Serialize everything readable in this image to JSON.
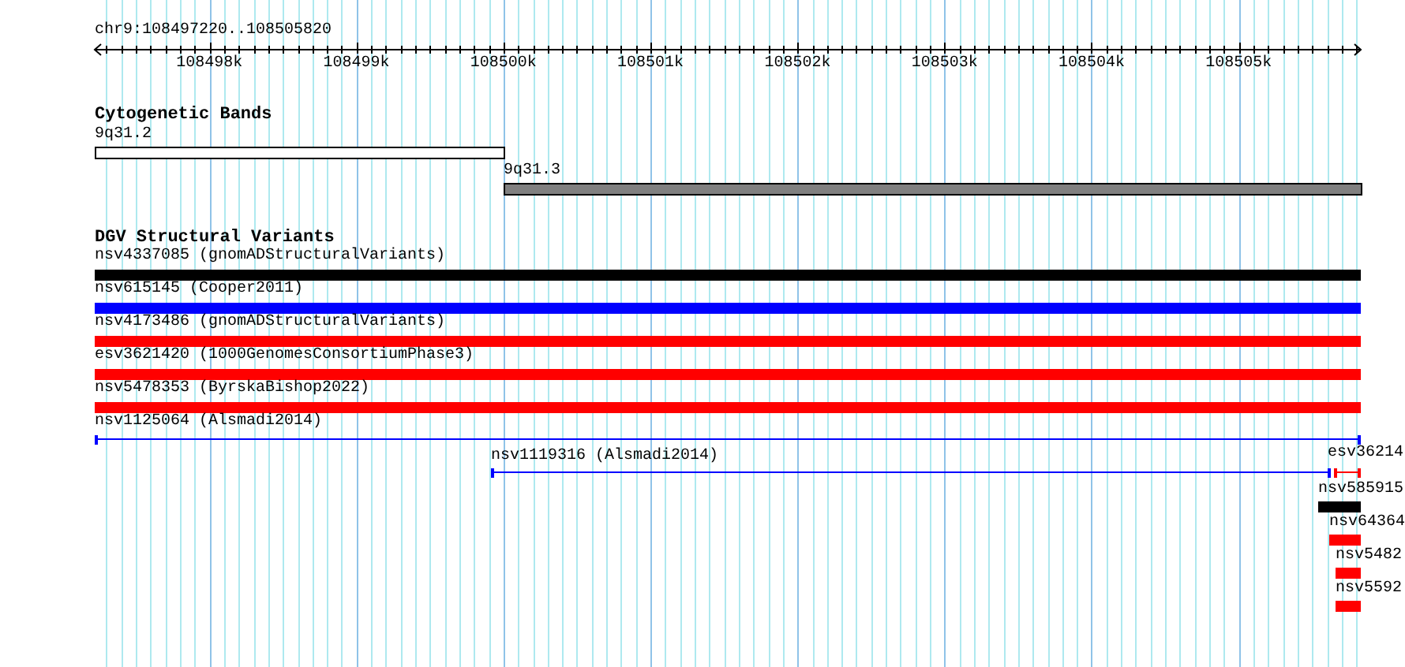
{
  "location": "chr9:108497220..108505820",
  "ruler": {
    "tick_labels": [
      "108498k",
      "108499k",
      "108500k",
      "108501k",
      "108502k",
      "108503k",
      "108504k",
      "108505k"
    ]
  },
  "tracks": [
    {
      "title": "Cytogenetic Bands",
      "features": [
        {
          "kind": "band",
          "label": "9q31.2",
          "color": "#ffffff"
        },
        {
          "kind": "band",
          "label": "9q31.3",
          "color": "#808080"
        }
      ]
    },
    {
      "title": "DGV Structural Variants",
      "features": [
        {
          "kind": "bar",
          "label": "nsv4337085 (gnomADStructuralVariants)",
          "color": "#000000"
        },
        {
          "kind": "bar",
          "label": "nsv615145 (Cooper2011)",
          "color": "#0000ff"
        },
        {
          "kind": "bar",
          "label": "nsv4173486 (gnomADStructuralVariants)",
          "color": "#ff0000"
        },
        {
          "kind": "bar",
          "label": "esv3621420 (1000GenomesConsortiumPhase3)",
          "color": "#ff0000"
        },
        {
          "kind": "bar",
          "label": "nsv5478353 (ByrskaBishop2022)",
          "color": "#ff0000"
        },
        {
          "kind": "line",
          "label": "nsv1125064 (Alsmadi2014)",
          "color": "#0000ff"
        },
        {
          "kind": "line",
          "label": "nsv1119316 (Alsmadi2014)",
          "color": "#0000ff"
        },
        {
          "kind": "line",
          "label": "esv36214",
          "color": "#ff0000"
        },
        {
          "kind": "bar",
          "label": "nsv585915",
          "color": "#000000"
        },
        {
          "kind": "bar",
          "label": "nsv64364",
          "color": "#ff0000"
        },
        {
          "kind": "bar",
          "label": "nsv5482",
          "color": "#ff0000"
        },
        {
          "kind": "bar",
          "label": "nsv5592",
          "color": "#ff0000"
        }
      ]
    }
  ]
}
